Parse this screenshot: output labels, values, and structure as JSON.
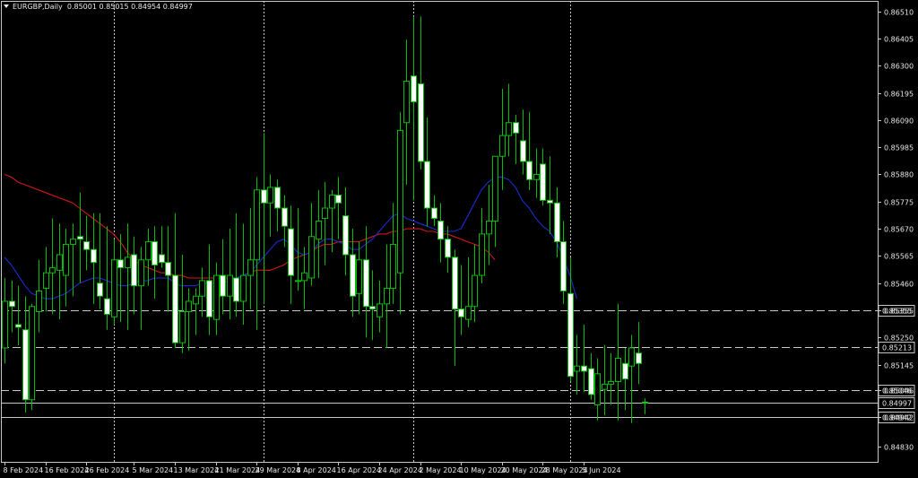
{
  "header": {
    "symbol": "EURGBP,Daily",
    "ohlc": [
      "0.85001",
      "0.85015",
      "0.84954",
      "0.84997"
    ]
  },
  "colors": {
    "background": "#000000",
    "frame": "#c8c8c8",
    "bull": "#00c000",
    "bear_body": "#ffffff",
    "ma_fast": "#1e2bd0",
    "ma_slow": "#d01818",
    "hline": "#c8c8c8",
    "vgrid": "#c8c8c8"
  },
  "chart_data": {
    "type": "candlestick",
    "ylim": [
      0.8477,
      0.8655
    ],
    "y_ticks": [
      "0.86510",
      "0.86405",
      "0.86300",
      "0.86195",
      "0.86090",
      "0.85985",
      "0.85880",
      "0.85775",
      "0.85670",
      "0.85565",
      "0.85460",
      "0.85355",
      "0.85250",
      "0.85145",
      "0.85046",
      "0.84942",
      "0.84830"
    ],
    "y_tick_values": [
      0.8651,
      0.86405,
      0.863,
      0.86195,
      0.8609,
      0.85985,
      0.8588,
      0.85775,
      0.8567,
      0.85565,
      0.8546,
      0.85355,
      0.8525,
      0.85145,
      0.85046,
      0.84942,
      0.8483
    ],
    "x_ticks": [
      {
        "label": "8 Feb 2024",
        "i": 0
      },
      {
        "label": "16 Feb 2024",
        "i": 6
      },
      {
        "label": "26 Feb 2024",
        "i": 12
      },
      {
        "label": "5 Mar 2024",
        "i": 19
      },
      {
        "label": "13 Mar 2024",
        "i": 25
      },
      {
        "label": "21 Mar 2024",
        "i": 31
      },
      {
        "label": "29 Mar 2024",
        "i": 37
      },
      {
        "label": "8 Apr 2024",
        "i": 43
      },
      {
        "label": "16 Apr 2024",
        "i": 49
      },
      {
        "label": "24 Apr 2024",
        "i": 55
      },
      {
        "label": "2 May 2024",
        "i": 61
      },
      {
        "label": "10 May 2024",
        "i": 67
      },
      {
        "label": "20 May 2024",
        "i": 73
      },
      {
        "label": "28 May 2024",
        "i": 79
      },
      {
        "label": "5 Jun 2024",
        "i": 85
      }
    ],
    "vgrid_at": [
      16,
      38,
      60,
      83
    ],
    "hlines": [
      {
        "value": 0.85355,
        "label": "0.85355",
        "style": "dashed"
      },
      {
        "value": 0.85213,
        "label": "0.85213",
        "style": "dashed"
      },
      {
        "value": 0.85046,
        "label": "0.85046",
        "style": "dashed"
      },
      {
        "value": 0.84997,
        "label": "0.84997",
        "style": "solid"
      },
      {
        "value": 0.84942,
        "label": "0.84942",
        "style": "solid"
      }
    ],
    "candles": [
      [
        0.8521,
        0.8548,
        0.8515,
        0.8539
      ],
      [
        0.8539,
        0.8547,
        0.8527,
        0.8537
      ],
      [
        0.853,
        0.8545,
        0.8522,
        0.8529
      ],
      [
        0.8528,
        0.8541,
        0.8496,
        0.8501
      ],
      [
        0.8501,
        0.8538,
        0.8497,
        0.8537
      ],
      [
        0.8535,
        0.8555,
        0.8527,
        0.8543
      ],
      [
        0.8544,
        0.856,
        0.8535,
        0.855
      ],
      [
        0.855,
        0.8571,
        0.8534,
        0.8552
      ],
      [
        0.8551,
        0.8569,
        0.8532,
        0.8557
      ],
      [
        0.8549,
        0.8567,
        0.8537,
        0.8561
      ],
      [
        0.8561,
        0.8569,
        0.8541,
        0.8563
      ],
      [
        0.8564,
        0.8581,
        0.8546,
        0.8563
      ],
      [
        0.8562,
        0.8572,
        0.8551,
        0.8559
      ],
      [
        0.8559,
        0.8573,
        0.8538,
        0.8554
      ],
      [
        0.8546,
        0.8573,
        0.8536,
        0.8541
      ],
      [
        0.854,
        0.8568,
        0.8528,
        0.8534
      ],
      [
        0.8533,
        0.8563,
        0.853,
        0.8555
      ],
      [
        0.8555,
        0.8565,
        0.8531,
        0.8552
      ],
      [
        0.8552,
        0.8569,
        0.8528,
        0.8556
      ],
      [
        0.8557,
        0.8564,
        0.8534,
        0.8545
      ],
      [
        0.8545,
        0.856,
        0.8528,
        0.8555
      ],
      [
        0.8555,
        0.8567,
        0.8545,
        0.8562
      ],
      [
        0.8562,
        0.8568,
        0.854,
        0.8553
      ],
      [
        0.8557,
        0.8568,
        0.8552,
        0.8554
      ],
      [
        0.8554,
        0.8568,
        0.8535,
        0.8549
      ],
      [
        0.8549,
        0.8573,
        0.8521,
        0.8523
      ],
      [
        0.8523,
        0.8557,
        0.8519,
        0.8535
      ],
      [
        0.8535,
        0.8544,
        0.852,
        0.8539
      ],
      [
        0.8538,
        0.8544,
        0.8526,
        0.8541
      ],
      [
        0.8541,
        0.8552,
        0.8533,
        0.8547
      ],
      [
        0.8547,
        0.8561,
        0.8526,
        0.8533
      ],
      [
        0.8532,
        0.8554,
        0.8526,
        0.8549
      ],
      [
        0.8549,
        0.8563,
        0.8534,
        0.8541
      ],
      [
        0.8541,
        0.8567,
        0.8532,
        0.8549
      ],
      [
        0.8548,
        0.8573,
        0.8533,
        0.8539
      ],
      [
        0.8539,
        0.8569,
        0.853,
        0.8549
      ],
      [
        0.8549,
        0.8575,
        0.8536,
        0.8555
      ],
      [
        0.8555,
        0.8587,
        0.8528,
        0.8582
      ],
      [
        0.8582,
        0.8604,
        0.8538,
        0.8577
      ],
      [
        0.8577,
        0.8588,
        0.8564,
        0.8583
      ],
      [
        0.8583,
        0.8586,
        0.8566,
        0.8575
      ],
      [
        0.8575,
        0.858,
        0.856,
        0.8568
      ],
      [
        0.8567,
        0.8576,
        0.8538,
        0.8549
      ],
      [
        0.8547,
        0.8575,
        0.8543,
        0.8547
      ],
      [
        0.8547,
        0.856,
        0.8536,
        0.855
      ],
      [
        0.8548,
        0.8577,
        0.8545,
        0.8564
      ],
      [
        0.8563,
        0.8582,
        0.8548,
        0.857
      ],
      [
        0.8571,
        0.8585,
        0.8553,
        0.8575
      ],
      [
        0.8575,
        0.8582,
        0.8558,
        0.858
      ],
      [
        0.858,
        0.8587,
        0.8563,
        0.8577
      ],
      [
        0.8572,
        0.8583,
        0.8549,
        0.8557
      ],
      [
        0.8557,
        0.8567,
        0.8533,
        0.8541
      ],
      [
        0.8542,
        0.8562,
        0.8534,
        0.8555
      ],
      [
        0.8555,
        0.8568,
        0.8525,
        0.8537
      ],
      [
        0.8537,
        0.8551,
        0.8524,
        0.8536
      ],
      [
        0.8533,
        0.8547,
        0.8527,
        0.8538
      ],
      [
        0.8538,
        0.8561,
        0.8521,
        0.8544
      ],
      [
        0.8544,
        0.8577,
        0.8538,
        0.8561
      ],
      [
        0.855,
        0.8612,
        0.8534,
        0.8605
      ],
      [
        0.8608,
        0.864,
        0.8584,
        0.8624
      ],
      [
        0.8626,
        0.8649,
        0.8578,
        0.8616
      ],
      [
        0.8623,
        0.8649,
        0.859,
        0.8593
      ],
      [
        0.8593,
        0.861,
        0.8568,
        0.8575
      ],
      [
        0.8575,
        0.858,
        0.8568,
        0.8571
      ],
      [
        0.857,
        0.8577,
        0.8554,
        0.8563
      ],
      [
        0.8563,
        0.8568,
        0.855,
        0.8556
      ],
      [
        0.8556,
        0.8559,
        0.8514,
        0.8536
      ],
      [
        0.8536,
        0.8553,
        0.8526,
        0.8533
      ],
      [
        0.8532,
        0.8556,
        0.8529,
        0.8537
      ],
      [
        0.8537,
        0.8561,
        0.8531,
        0.8549
      ],
      [
        0.8549,
        0.8575,
        0.8546,
        0.8565
      ],
      [
        0.8565,
        0.8584,
        0.8553,
        0.857
      ],
      [
        0.857,
        0.8592,
        0.856,
        0.8595
      ],
      [
        0.8595,
        0.8621,
        0.8582,
        0.8603
      ],
      [
        0.8603,
        0.8623,
        0.8595,
        0.8608
      ],
      [
        0.8608,
        0.8611,
        0.8592,
        0.8604
      ],
      [
        0.8601,
        0.8613,
        0.8588,
        0.8593
      ],
      [
        0.8593,
        0.8612,
        0.8582,
        0.8586
      ],
      [
        0.8586,
        0.8598,
        0.8579,
        0.8588
      ],
      [
        0.8592,
        0.8598,
        0.8576,
        0.8578
      ],
      [
        0.8578,
        0.8595,
        0.8565,
        0.8577
      ],
      [
        0.8577,
        0.8583,
        0.8556,
        0.8562
      ],
      [
        0.8562,
        0.857,
        0.8538,
        0.8543
      ],
      [
        0.8542,
        0.8556,
        0.8508,
        0.851
      ],
      [
        0.8512,
        0.8526,
        0.8503,
        0.8514
      ],
      [
        0.8514,
        0.853,
        0.8504,
        0.8512
      ],
      [
        0.8513,
        0.8519,
        0.8501,
        0.8503
      ],
      [
        0.8499,
        0.8517,
        0.8493,
        0.8511
      ],
      [
        0.8505,
        0.8522,
        0.8495,
        0.8507
      ],
      [
        0.8507,
        0.8519,
        0.8499,
        0.8508
      ],
      [
        0.8508,
        0.8538,
        0.8493,
        0.8517
      ],
      [
        0.8515,
        0.8521,
        0.8497,
        0.8509
      ],
      [
        0.8514,
        0.8526,
        0.8492,
        0.8521
      ],
      [
        0.8519,
        0.8531,
        0.8507,
        0.8515
      ],
      [
        0.85001,
        0.85015,
        0.84954,
        0.84997
      ]
    ],
    "ma_fast": [
      0.8556,
      0.8553,
      0.8549,
      0.8545,
      0.8542,
      0.8541,
      0.854,
      0.854,
      0.8541,
      0.8542,
      0.8544,
      0.8546,
      0.8547,
      0.8548,
      0.8548,
      0.8547,
      0.8546,
      0.8545,
      0.8545,
      0.8546,
      0.8547,
      0.8547,
      0.8548,
      0.8548,
      0.8548,
      0.8546,
      0.8545,
      0.8545,
      0.8545,
      0.8546,
      0.8546,
      0.8546,
      0.8546,
      0.8547,
      0.8548,
      0.8549,
      0.855,
      0.8553,
      0.8556,
      0.8559,
      0.8562,
      0.8563,
      0.8561,
      0.8558,
      0.8557,
      0.8558,
      0.8561,
      0.8563,
      0.8563,
      0.8562,
      0.8561,
      0.8559,
      0.8559,
      0.8561,
      0.8563,
      0.8566,
      0.8569,
      0.8572,
      0.8573,
      0.8571,
      0.857,
      0.8569,
      0.8568,
      0.8567,
      0.8566,
      0.8566,
      0.8566,
      0.8567,
      0.8572,
      0.8577,
      0.8582,
      0.8585,
      0.8587,
      0.8587,
      0.8586,
      0.8583,
      0.8578,
      0.8575,
      0.8571,
      0.8568,
      0.8566,
      0.8562,
      0.8556,
      0.8549,
      0.854
    ],
    "ma_slow": [
      0.8588,
      0.8587,
      0.8585,
      0.8584,
      0.8583,
      0.8582,
      0.8581,
      0.858,
      0.8579,
      0.8578,
      0.8577,
      0.8575,
      0.8573,
      0.8571,
      0.8569,
      0.8567,
      0.8565,
      0.8562,
      0.8558,
      0.8555,
      0.8553,
      0.8552,
      0.8551,
      0.855,
      0.855,
      0.8549,
      0.8549,
      0.8548,
      0.8548,
      0.8548,
      0.8548,
      0.8548,
      0.8548,
      0.8548,
      0.8548,
      0.8549,
      0.855,
      0.8551,
      0.8551,
      0.8551,
      0.8552,
      0.8553,
      0.8555,
      0.8556,
      0.8557,
      0.8558,
      0.856,
      0.8561,
      0.8561,
      0.8562,
      0.8562,
      0.8562,
      0.8562,
      0.8563,
      0.8564,
      0.8565,
      0.8565,
      0.8566,
      0.8566,
      0.8567,
      0.8567,
      0.8567,
      0.8566,
      0.8566,
      0.8565,
      0.8565,
      0.8564,
      0.8563,
      0.8562,
      0.8561,
      0.856,
      0.8558,
      0.8555
    ]
  }
}
